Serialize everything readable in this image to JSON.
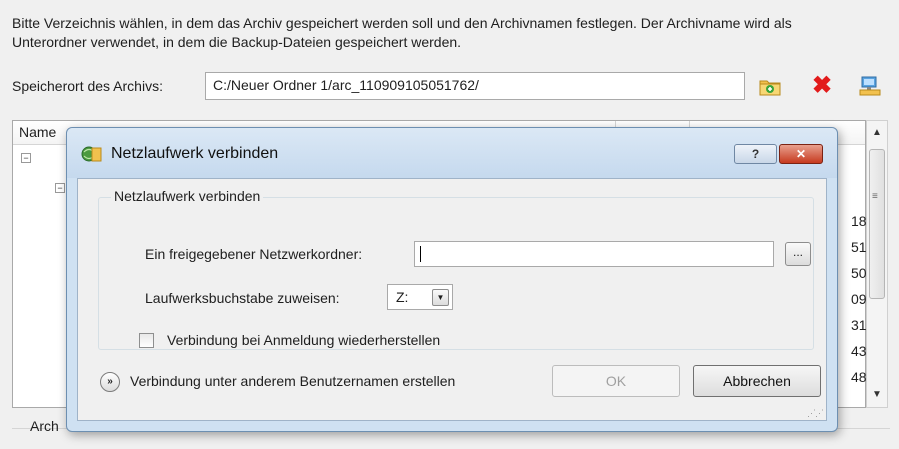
{
  "background": {
    "instructions": "Bitte Verzeichnis wählen, in dem das Archiv gespeichert werden soll und den Archivnamen festlegen. Der Archivname wird als Unterordner verwendet, in dem die Backup-Dateien gespeichert werden.",
    "location_label": "Speicherort des Archivs:",
    "location_value": "C:/Neuer Ordner 1/arc_110909105051762/",
    "tree_header_name": "Name",
    "partial_numbers": [
      "18",
      "51",
      "50",
      "09",
      "31",
      "43",
      "48"
    ],
    "archive_label": "Arch",
    "icons": [
      "new-folder-icon",
      "delete-icon",
      "network-drive-icon"
    ]
  },
  "dialog": {
    "title": "Netzlaufwerk verbinden",
    "help_glyph": "?",
    "close_glyph": "✕",
    "group_title": "Netzlaufwerk verbinden",
    "share_label": "Ein freigegebener Netzwerkordner:",
    "share_value": "",
    "browse_label": "...",
    "drive_label": "Laufwerksbuchstabe zuweisen:",
    "drive_value": "Z:",
    "reconnect_label": "Verbindung bei Anmeldung wiederherstellen",
    "reconnect_checked": false,
    "more_label": "Verbindung unter anderem Benutzernamen erstellen",
    "ok_label": "OK",
    "cancel_label": "Abbrechen"
  },
  "colors": {
    "dialog_frame": "#cfe1f2",
    "close_button": "#c63a1f",
    "delete_icon": "#e21b1b"
  }
}
